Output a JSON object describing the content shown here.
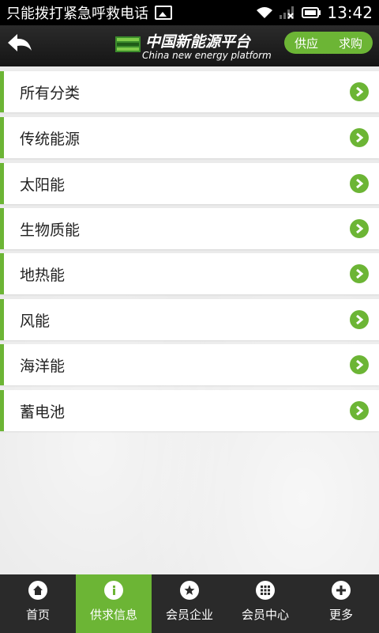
{
  "status_bar": {
    "carrier_text": "只能拨打紧急呼救电话",
    "time": "13:42"
  },
  "header": {
    "title": "中国新能源平台",
    "subtitle": "China new energy platform",
    "toggle": {
      "supply": "供应",
      "demand": "求购"
    }
  },
  "categories": [
    {
      "label": "所有分类"
    },
    {
      "label": "传统能源"
    },
    {
      "label": "太阳能"
    },
    {
      "label": "生物质能"
    },
    {
      "label": "地热能"
    },
    {
      "label": "风能"
    },
    {
      "label": "海洋能"
    },
    {
      "label": "蓄电池"
    }
  ],
  "tabs": [
    {
      "label": "首页",
      "icon": "home-icon"
    },
    {
      "label": "供求信息",
      "icon": "info-icon",
      "active": true
    },
    {
      "label": "会员企业",
      "icon": "star-icon"
    },
    {
      "label": "会员中心",
      "icon": "grid-icon"
    },
    {
      "label": "更多",
      "icon": "plus-icon"
    }
  ],
  "colors": {
    "accent": "#6cb535",
    "bar": "#2a2a2a"
  }
}
